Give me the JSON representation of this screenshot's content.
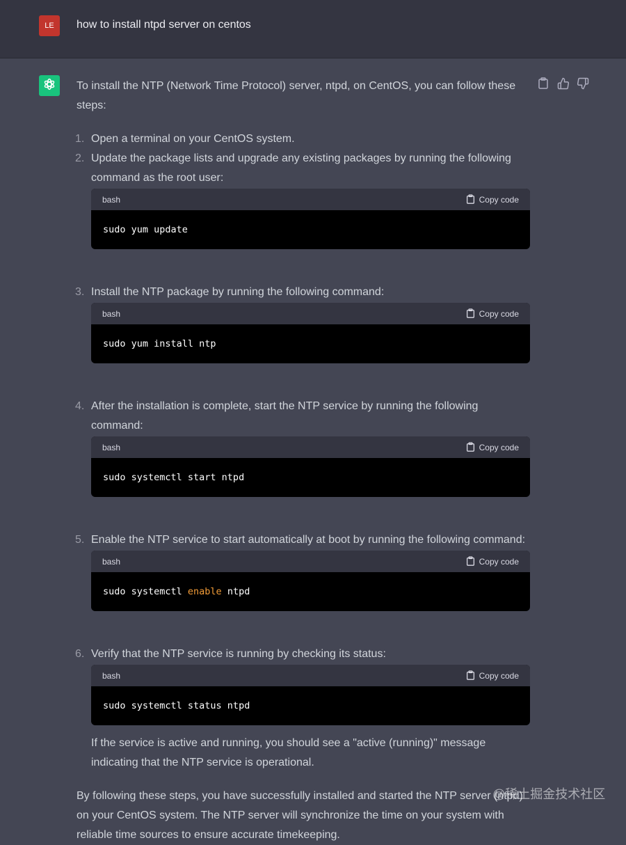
{
  "user": {
    "avatar_initials": "LE",
    "avatar_color": "#c2352d",
    "message": "how to install ntpd server on centos"
  },
  "assistant": {
    "avatar_icon": "openai-logo-icon",
    "avatar_color": "#19c37d",
    "actions": [
      "clipboard-icon",
      "thumbs-up-icon",
      "thumbs-down-icon"
    ],
    "intro": "To install the NTP (Network Time Protocol) server, ntpd, on CentOS, you can follow these steps:",
    "steps": [
      {
        "number": "1.",
        "text": "Open a terminal on your CentOS system."
      },
      {
        "number": "2.",
        "text": "Update the package lists and upgrade any existing packages by running the following command as the root user:",
        "code": {
          "lang": "bash",
          "copy_label": "Copy code",
          "cmd_before": "sudo yum update",
          "cmd_keyword": "",
          "cmd_after": ""
        }
      },
      {
        "number": "3.",
        "text": "Install the NTP package by running the following command:",
        "code": {
          "lang": "bash",
          "copy_label": "Copy code",
          "cmd_before": "sudo yum install ntp",
          "cmd_keyword": "",
          "cmd_after": ""
        }
      },
      {
        "number": "4.",
        "text": "After the installation is complete, start the NTP service by running the following command:",
        "code": {
          "lang": "bash",
          "copy_label": "Copy code",
          "cmd_before": "sudo systemctl start ntpd",
          "cmd_keyword": "",
          "cmd_after": ""
        }
      },
      {
        "number": "5.",
        "text": "Enable the NTP service to start automatically at boot by running the following command:",
        "code": {
          "lang": "bash",
          "copy_label": "Copy code",
          "cmd_before": "sudo systemctl ",
          "cmd_keyword": "enable",
          "cmd_after": " ntpd"
        }
      },
      {
        "number": "6.",
        "text": "Verify that the NTP service is running by checking its status:",
        "code": {
          "lang": "bash",
          "copy_label": "Copy code",
          "cmd_before": "sudo systemctl status ntpd",
          "cmd_keyword": "",
          "cmd_after": ""
        }
      }
    ],
    "note": "If the service is active and running, you should see a \"active (running)\" message indicating that the NTP service is operational.",
    "outro": "By following these steps, you have successfully installed and started the NTP server (ntpd) on your CentOS system. The NTP server will synchronize the time on your system with reliable time sources to ensure accurate timekeeping."
  },
  "keyword_color": "#f29c38",
  "watermark": "@稀土掘金技术社区"
}
